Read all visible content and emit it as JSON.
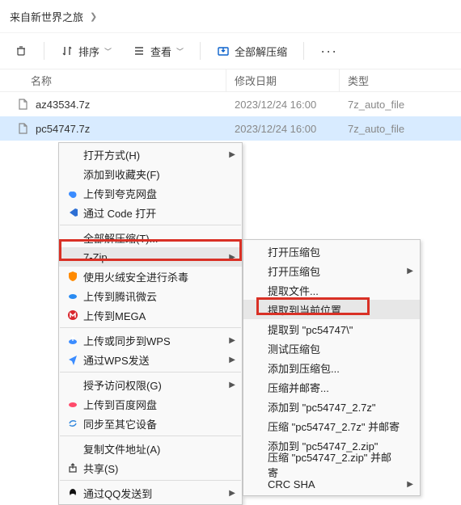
{
  "breadcrumb": {
    "title": "来自新世界之旅"
  },
  "toolbar": {
    "sort": "排序",
    "view": "查看",
    "extract_all": "全部解压缩"
  },
  "columns": {
    "name": "名称",
    "date": "修改日期",
    "type": "类型"
  },
  "files": [
    {
      "name": "az43534.7z",
      "date": "2023/12/24 16:00",
      "type": "7z_auto_file"
    },
    {
      "name": "pc54747.7z",
      "date": "2023/12/24 16:00",
      "type": "7z_auto_file"
    }
  ],
  "menu1": {
    "open_with": "打开方式(H)",
    "add_fav": "添加到收藏夹(F)",
    "upload_quark": "上传到夸克网盘",
    "open_code": "通过 Code 打开",
    "extract_all": "全部解压缩(T)...",
    "seven_zip": "7-Zip",
    "huorong": "使用火绒安全进行杀毒",
    "weiyun": "上传到腾讯微云",
    "mega": "上传到MEGA",
    "wps_sync": "上传或同步到WPS",
    "wps_send": "通过WPS发送",
    "access": "授予访问权限(G)",
    "baidu": "上传到百度网盘",
    "sync_devices": "同步至其它设备",
    "copy_path": "复制文件地址(A)",
    "share": "共享(S)",
    "qq_send": "通过QQ发送到"
  },
  "menu2": {
    "open_archive": "打开压缩包",
    "open_archive2": "打开压缩包",
    "extract_files": "提取文件...",
    "extract_here": "提取到当前位置",
    "extract_to": "提取到 \"pc54747\\\"",
    "test": "测试压缩包",
    "add_to": "添加到压缩包...",
    "compress_mail": "压缩并邮寄...",
    "add_7z": "添加到 \"pc54747_2.7z\"",
    "compress_7z_mail": "压缩 \"pc54747_2.7z\" 并邮寄",
    "add_zip": "添加到 \"pc54747_2.zip\"",
    "compress_zip_mail": "压缩 \"pc54747_2.zip\" 并邮寄",
    "crc": "CRC SHA"
  }
}
